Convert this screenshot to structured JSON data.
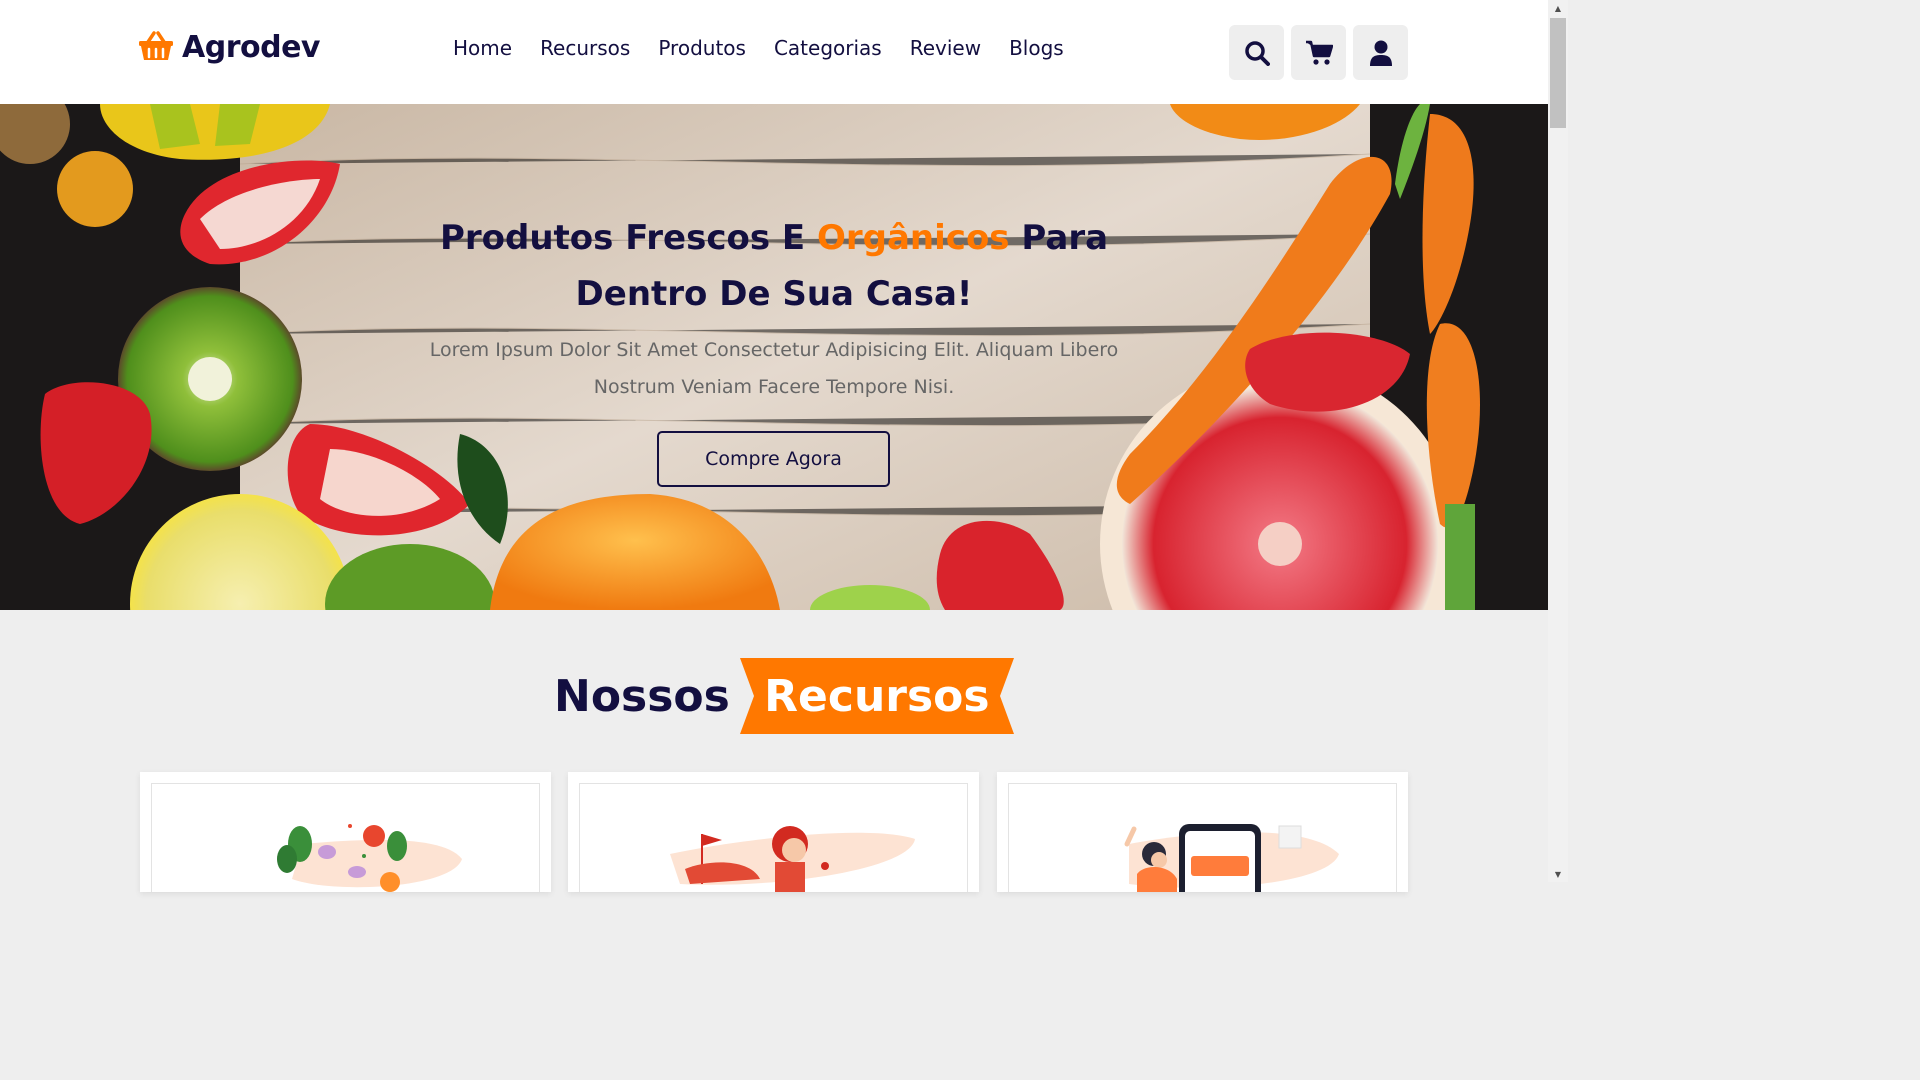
{
  "brand": {
    "name": "Agrodev",
    "accent_color": "#ff7800",
    "dark_color": "#130f40"
  },
  "nav": {
    "items": [
      {
        "label": "Home"
      },
      {
        "label": "Recursos"
      },
      {
        "label": "Produtos"
      },
      {
        "label": "Categorias"
      },
      {
        "label": "Review"
      },
      {
        "label": "Blogs"
      }
    ]
  },
  "header_icons": [
    "search-icon",
    "cart-icon",
    "user-icon"
  ],
  "hero": {
    "title_part1": "Produtos Frescos E",
    "title_accent": "Orgânicos",
    "title_part2": "Para Dentro De Sua Casa!",
    "description": "Lorem Ipsum Dolor Sit Amet Consectetur Adipisicing Elit. Aliquam Libero Nostrum Veniam Facere Tempore Nisi.",
    "button_label": "Compre Agora"
  },
  "features": {
    "heading_main": "Nossos",
    "heading_accent": "Recursos"
  }
}
